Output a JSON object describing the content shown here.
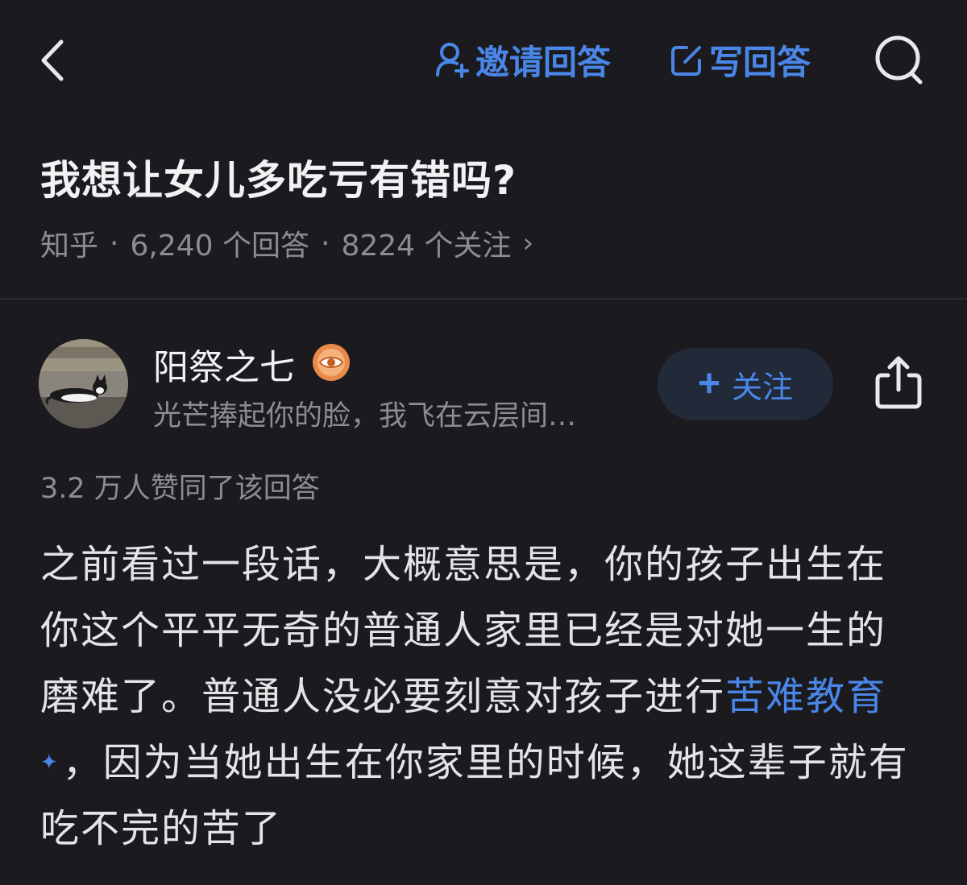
{
  "header": {
    "invite_label": "邀请回答",
    "write_label": "写回答",
    "accent_color": "#4a86e8",
    "icons": [
      "back-chevron-icon",
      "invite-person-icon",
      "edit-icon",
      "search-icon"
    ]
  },
  "question": {
    "title": "我想让女儿多吃亏有错吗?",
    "source": "知乎",
    "separator": "·",
    "answers": "6,240 个回答",
    "followers": "8224 个关注",
    "chevron": "›"
  },
  "answer": {
    "author": {
      "name": "阳祭之七",
      "bio": "光芒捧起你的脸，我飞在云层间…",
      "follow_plus": "+",
      "follow_label": "关注",
      "badge_icon": "eye-badge-icon"
    },
    "votes": "3.2 万人赞同了该回答",
    "content": {
      "part1": "之前看过一段话，大概意思是，你的孩子出生在你这个平平无奇的普通人家里已经是对她一生的磨难了。普通人没必要刻意对孩子进行",
      "link_text": "苦难教育",
      "link_mark": "✦",
      "part2": "，因为当她出生在你家里的时候，她这辈子就有吃不完的苦了"
    }
  }
}
